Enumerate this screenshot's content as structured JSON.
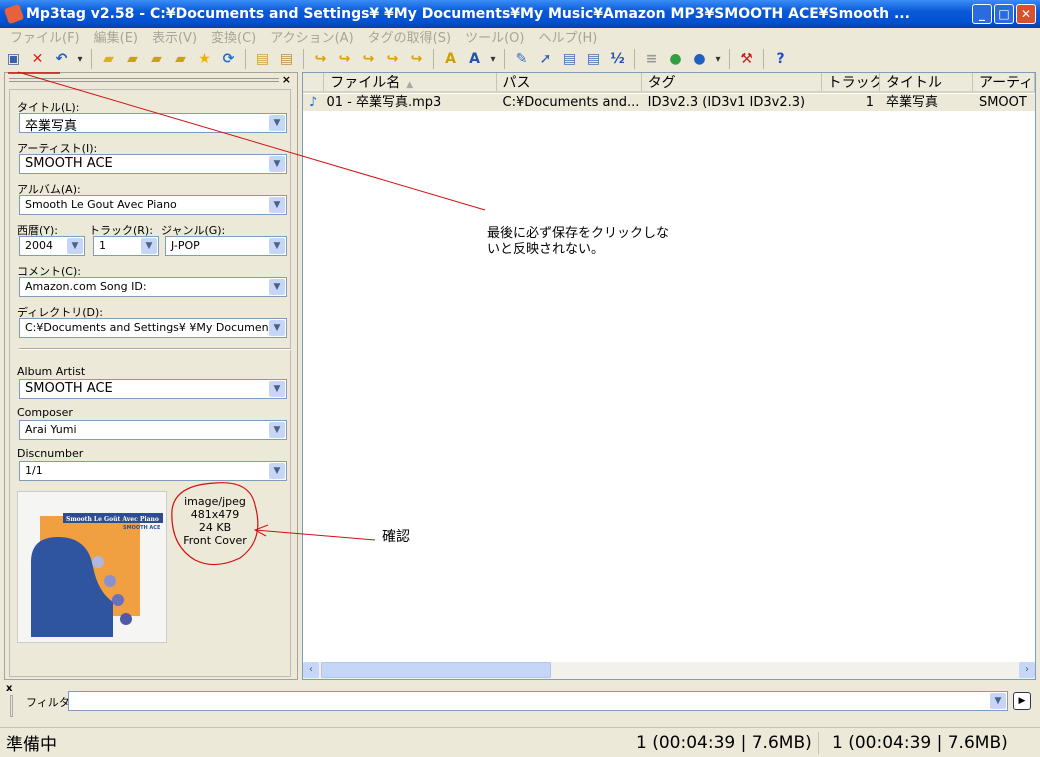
{
  "window": {
    "title": "Mp3tag v2.58  -  C:¥Documents and Settings¥        ¥My Documents¥My Music¥Amazon MP3¥SMOOTH  ACE¥Smooth ...",
    "minimize": "_",
    "maximize": "□",
    "close": "✕"
  },
  "menu": [
    "ファイル(F)",
    "編集(E)",
    "表示(V)",
    "変換(C)",
    "アクション(A)",
    "タグの取得(S)",
    "ツール(O)",
    "ヘルプ(H)"
  ],
  "toolbar": [
    {
      "icon": "save-icon",
      "glyph": "▣",
      "color": "#3a5ea8"
    },
    {
      "icon": "remove-tag-icon",
      "glyph": "✕",
      "color": "#e02020"
    },
    {
      "icon": "undo-icon",
      "glyph": "↶",
      "color": "#2060c0"
    },
    {
      "icon": "dropdown-icon",
      "glyph": "▾",
      "color": "#333"
    },
    {
      "sep": true
    },
    {
      "icon": "change-directory-icon",
      "glyph": "▰",
      "color": "#d8b020"
    },
    {
      "icon": "add-directory-icon",
      "glyph": "▰",
      "color": "#c8a020"
    },
    {
      "icon": "folder-icon",
      "glyph": "▰",
      "color": "#c8a020"
    },
    {
      "icon": "folder-refresh-icon",
      "glyph": "▰",
      "color": "#c8a020"
    },
    {
      "icon": "favorite-star-icon",
      "glyph": "★",
      "color": "#f0b000"
    },
    {
      "icon": "refresh-icon",
      "glyph": "⟳",
      "color": "#2070d0"
    },
    {
      "sep": true
    },
    {
      "icon": "export-icon",
      "glyph": "▤",
      "color": "#d0a040"
    },
    {
      "icon": "print-icon",
      "glyph": "▤",
      "color": "#c09040"
    },
    {
      "sep": true
    },
    {
      "icon": "tag-filename-icon",
      "glyph": "↪",
      "color": "#e0a000"
    },
    {
      "icon": "filename-tag-icon",
      "glyph": "↪",
      "color": "#e0a000"
    },
    {
      "icon": "filename-filename-icon",
      "glyph": "↪",
      "color": "#e0a000"
    },
    {
      "icon": "text-file-tag-icon",
      "glyph": "↪",
      "color": "#e0a000"
    },
    {
      "icon": "tag-tag-icon",
      "glyph": "↪",
      "color": "#e0a000"
    },
    {
      "sep": true
    },
    {
      "icon": "case-conversion-icon",
      "glyph": "A",
      "color": "#d0a000"
    },
    {
      "icon": "case-conversion-2-icon",
      "glyph": "A",
      "color": "#2050b0"
    },
    {
      "icon": "dropdown-icon",
      "glyph": "▾",
      "color": "#333"
    },
    {
      "sep": true
    },
    {
      "icon": "edit-icon",
      "glyph": "✎",
      "color": "#4070c0"
    },
    {
      "icon": "action-icon",
      "glyph": "➚",
      "color": "#3060b0"
    },
    {
      "icon": "playlist-icon",
      "glyph": "▤",
      "color": "#4070c0"
    },
    {
      "icon": "playlist-2-icon",
      "glyph": "▤",
      "color": "#4070c0"
    },
    {
      "icon": "numbering-icon",
      "glyph": "½",
      "color": "#2050b0"
    },
    {
      "sep": true
    },
    {
      "icon": "disc-icon",
      "glyph": "≡",
      "color": "#999"
    },
    {
      "icon": "web-source-icon",
      "glyph": "●",
      "color": "#30a040"
    },
    {
      "icon": "freedb-icon",
      "glyph": "●",
      "color": "#2060c0"
    },
    {
      "icon": "dropdown-icon",
      "glyph": "▾",
      "color": "#333"
    },
    {
      "sep": true
    },
    {
      "icon": "tools-icon",
      "glyph": "⚒",
      "color": "#c02020"
    },
    {
      "sep": true
    },
    {
      "icon": "help-icon",
      "glyph": "?",
      "color": "#2050c0"
    }
  ],
  "panel": {
    "fields": [
      {
        "label": "タイトル(L):",
        "value": "卒業写真"
      },
      {
        "label": "アーティスト(I):",
        "value": "SMOOTH  ACE"
      },
      {
        "label": "アルバム(A):",
        "value": "Smooth Le Gout Avec Piano"
      },
      {
        "label": "西暦(Y):",
        "value": "2004"
      },
      {
        "label": "トラック(R):",
        "value": "1"
      },
      {
        "label": "ジャンル(G):",
        "value": "J-POP"
      },
      {
        "label": "コメント(C):",
        "value": "Amazon.com Song ID:"
      },
      {
        "label": "ディレクトリ(D):",
        "value": "C:¥Documents and Settings¥          ¥My Documents"
      },
      {
        "label": "Album Artist",
        "value": "SMOOTH  ACE"
      },
      {
        "label": "Composer",
        "value": "Arai Yumi"
      },
      {
        "label": "Discnumber",
        "value": "1/1"
      }
    ],
    "cover": {
      "title_text": "Smooth Le Goût Avec Piano",
      "artist_text": "SMOOTH ACE"
    },
    "image_info": [
      "image/jpeg",
      "481x479",
      "24 KB",
      "Front Cover"
    ]
  },
  "list": {
    "columns": [
      "ファイル名",
      "パス",
      "タグ",
      "トラック",
      "タイトル",
      "アーティス"
    ],
    "rows": [
      [
        "01 - 卒業写真.mp3",
        "C:¥Documents and...",
        "ID3v2.3 (ID3v1 ID3v2.3)",
        "1",
        "卒業写真",
        "SMOOT"
      ]
    ]
  },
  "filter": {
    "label": "フィルタ:",
    "value": ""
  },
  "status": {
    "text": "準備中",
    "selected": "1 (00:04:39 | 7.6MB)",
    "total": "1 (00:04:39 | 7.6MB)"
  },
  "annotations": {
    "save_note_line1": "最後に必ず保存をクリックしな",
    "save_note_line2": "いと反映されない。",
    "confirm_note": "確認",
    "color": "#d01010"
  }
}
